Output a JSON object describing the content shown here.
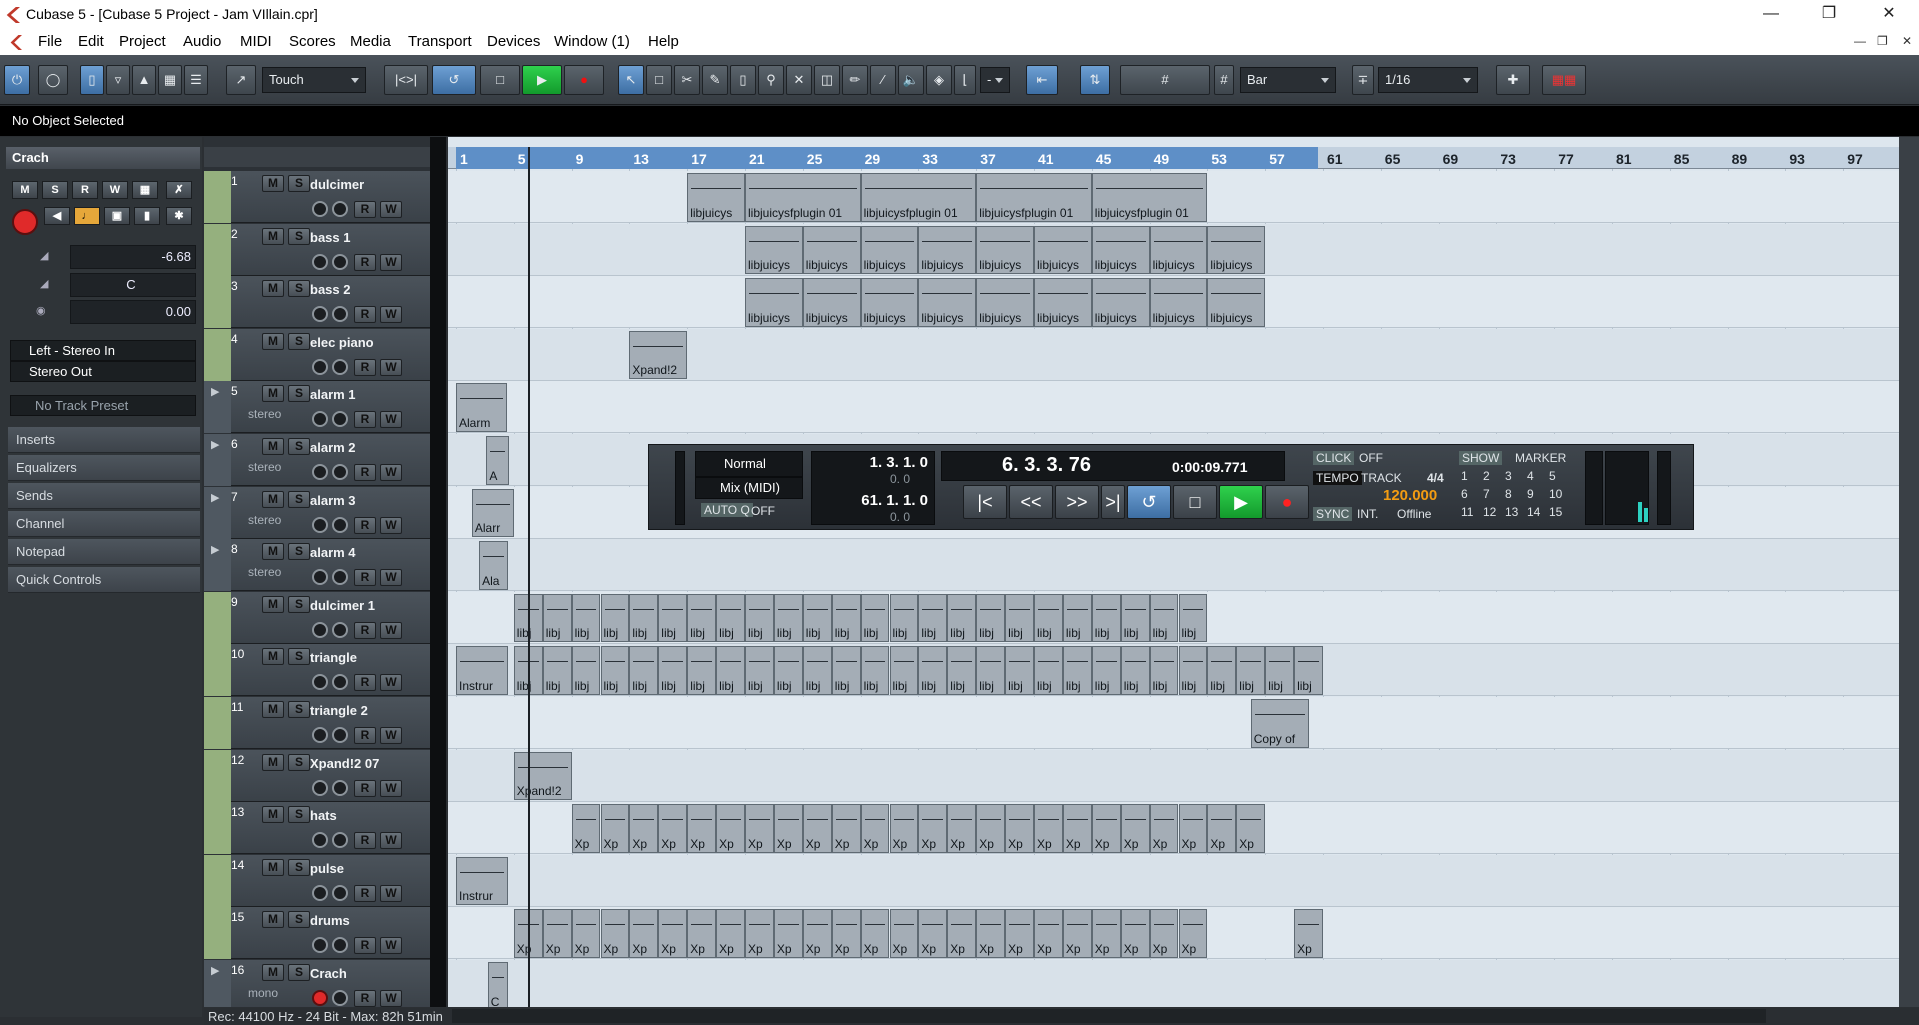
{
  "window": {
    "title": "Cubase 5 - [Cubase 5 Project - Jam VIllain.cpr]"
  },
  "menu": [
    "File",
    "Edit",
    "Project",
    "Audio",
    "MIDI",
    "Scores",
    "Media",
    "Transport",
    "Devices",
    "Window (1)",
    "Help"
  ],
  "toolbar": {
    "automation_mode": "Touch",
    "snap_type": "Bar",
    "quantize": "1/16",
    "nudge": "-"
  },
  "infoline": "No Object Selected",
  "inspector": {
    "track_name": "Crach",
    "volume": "-6.68",
    "pan": "C",
    "delay": "0.00",
    "input_routing": "Left - Stereo In",
    "output_routing": "Stereo Out",
    "preset": "No Track Preset",
    "sections": [
      "Inserts",
      "Equalizers",
      "Sends",
      "Channel",
      "Notepad",
      "Quick Controls"
    ]
  },
  "ruler": [
    "1",
    "5",
    "9",
    "13",
    "17",
    "21",
    "25",
    "29",
    "33",
    "37",
    "41",
    "45",
    "49",
    "53",
    "57",
    "61",
    "65",
    "69",
    "73",
    "77",
    "81",
    "85",
    "89",
    "93",
    "97",
    "1"
  ],
  "tracks": [
    {
      "n": "1",
      "name": "dulcimer",
      "sub": ""
    },
    {
      "n": "2",
      "name": "bass 1",
      "sub": ""
    },
    {
      "n": "3",
      "name": "bass 2",
      "sub": ""
    },
    {
      "n": "4",
      "name": "elec piano",
      "sub": ""
    },
    {
      "n": "5",
      "name": "alarm 1",
      "sub": "stereo"
    },
    {
      "n": "6",
      "name": "alarm 2",
      "sub": "stereo"
    },
    {
      "n": "7",
      "name": "alarm 3",
      "sub": "stereo"
    },
    {
      "n": "8",
      "name": "alarm 4",
      "sub": "stereo"
    },
    {
      "n": "9",
      "name": "dulcimer 1",
      "sub": ""
    },
    {
      "n": "10",
      "name": "triangle",
      "sub": ""
    },
    {
      "n": "11",
      "name": "triangle 2",
      "sub": ""
    },
    {
      "n": "12",
      "name": "Xpand!2 07",
      "sub": ""
    },
    {
      "n": "13",
      "name": "hats",
      "sub": ""
    },
    {
      "n": "14",
      "name": "pulse",
      "sub": ""
    },
    {
      "n": "15",
      "name": "drums",
      "sub": ""
    },
    {
      "n": "16",
      "name": "Crach",
      "sub": "mono"
    }
  ],
  "parts": {
    "p1a": "libjuicys",
    "p1b": "libjuicysfplugin 01",
    "p1c": "libjuicysfplugin 01",
    "p1d": "libjuicysfplugin 01",
    "p1e": "libjuicysfplugin 01",
    "p2": "libjuicys",
    "p3": "libjuicys",
    "p4": "Xpand!2",
    "p5": "Alarm",
    "p6": "A",
    "p7": "Alarr",
    "p8": "Ala",
    "p9": "libj",
    "p10a": "Instrur",
    "p10b": "libj",
    "p11": "Copy of",
    "p12": "Xpand!2",
    "p13": "Xp",
    "p14": "Instrur",
    "p15": "Xp",
    "p16": "C"
  },
  "transport": {
    "left_mode": "Normal",
    "cycle_mode": "Mix (MIDI)",
    "auto_q": "AUTO Q",
    "auto_q_state": "OFF",
    "left_locator": "1. 3. 1.   0",
    "left_sub": "0.  0",
    "right_locator": "61. 1. 1.   0",
    "right_sub": "0.  0",
    "position_bars": "6. 3. 3.  76",
    "position_time": "0:00:09.771",
    "click": "CLICK",
    "click_state": "OFF",
    "tempo": "TEMPO",
    "tempo_mode": "TRACK",
    "signature": "4/4",
    "tempo_value": "120.000",
    "sync": "SYNC",
    "sync_mode": "INT.",
    "sync_state": "Offline",
    "show": "SHOW",
    "marker": "MARKER",
    "markers": [
      "1",
      "2",
      "3",
      "4",
      "5",
      "6",
      "7",
      "8",
      "9",
      "10",
      "11",
      "12",
      "13",
      "14",
      "15"
    ]
  },
  "status": "Rec: 44100 Hz - 24 Bit - Max: 82h 51min"
}
